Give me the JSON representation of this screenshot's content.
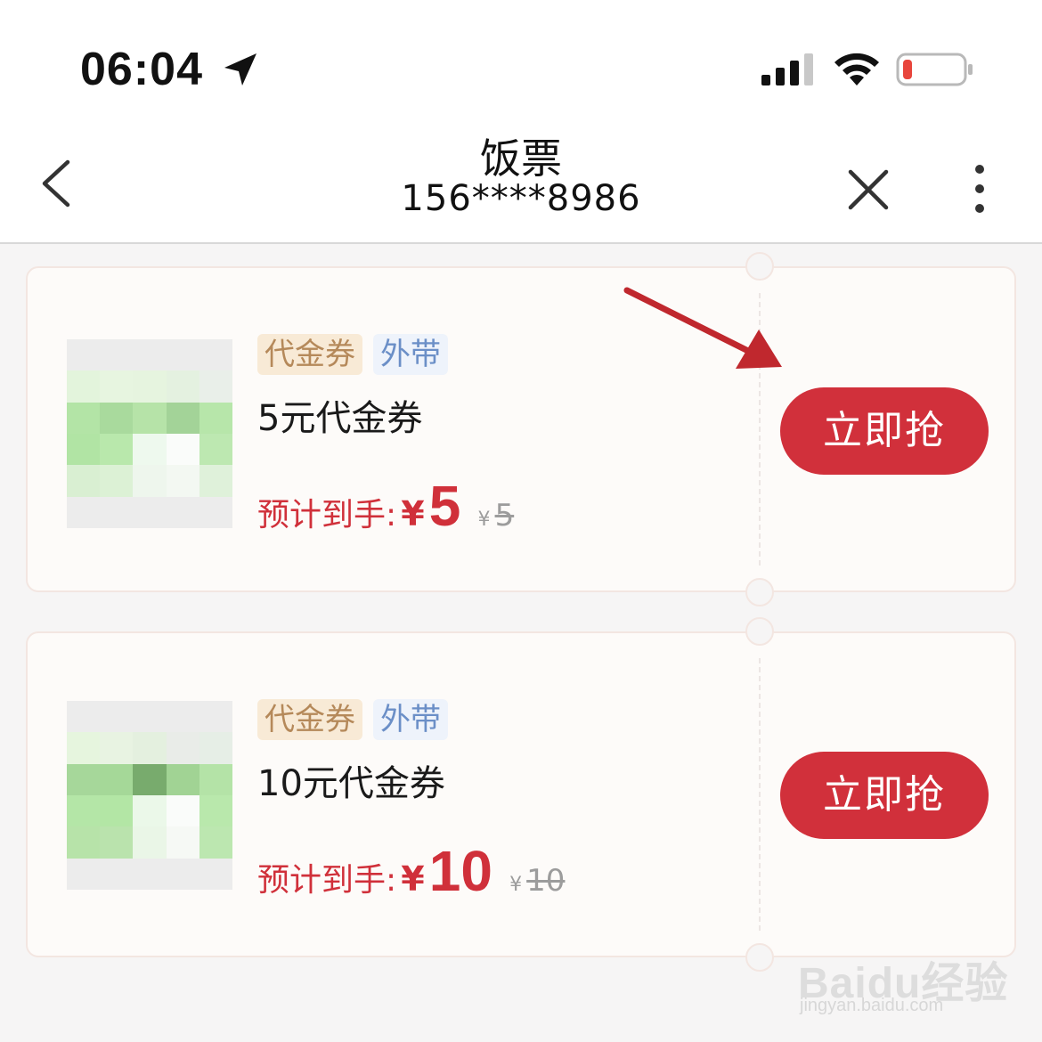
{
  "status_bar": {
    "time": "06:04",
    "icons": [
      "location-arrow-icon",
      "signal-icon",
      "wifi-icon",
      "battery-low-icon"
    ],
    "battery_color": "#e8453c"
  },
  "nav": {
    "title": "饭票",
    "subtitle": "156****8986",
    "icons": [
      "back-chevron-icon",
      "close-icon",
      "more-vertical-icon"
    ]
  },
  "coupons": [
    {
      "tags": [
        "代金券",
        "外带"
      ],
      "name": "5元代金券",
      "price_label": "预计到手:",
      "currency": "¥",
      "price": "5",
      "original_currency": "¥",
      "original_price": "5",
      "button_label": "立即抢"
    },
    {
      "tags": [
        "代金券",
        "外带"
      ],
      "name": "10元代金券",
      "price_label": "预计到手:",
      "currency": "¥",
      "price": "10",
      "original_currency": "¥",
      "original_price": "10",
      "button_label": "立即抢"
    }
  ],
  "watermark": {
    "brand": "Baidu经验",
    "url": "jingyan.baidu.com"
  },
  "colors": {
    "accent": "#d1303b",
    "voucher_tag_bg": "#f8ead6",
    "voucher_tag_text": "#b5895a",
    "takeaway_tag_bg": "#eef3fb",
    "takeaway_tag_text": "#6b8fc7",
    "annotation_arrow": "#c0282e"
  }
}
